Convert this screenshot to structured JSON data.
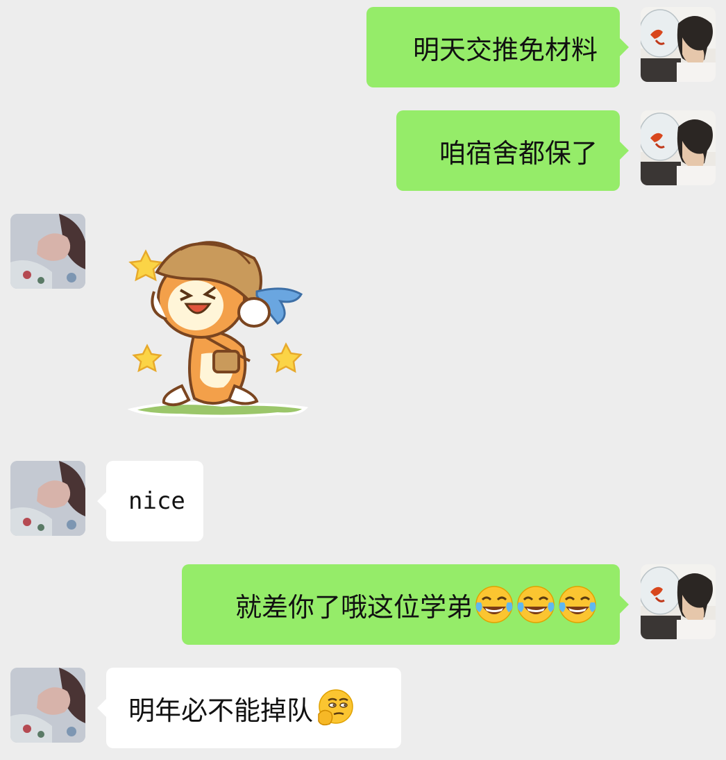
{
  "messages": [
    {
      "side": "me",
      "text": "明天交推免材料"
    },
    {
      "side": "me",
      "text": "咱宿舍都保了"
    },
    {
      "side": "them",
      "type": "sticker",
      "sticker": "running-puppy-with-hat-sticker"
    },
    {
      "side": "them",
      "text": "nice"
    },
    {
      "side": "me",
      "text": "就差你了哦这位学弟",
      "emojis": [
        "tears-of-joy-icon",
        "tears-of-joy-icon",
        "tears-of-joy-icon"
      ]
    },
    {
      "side": "them",
      "text": "明年必不能掉队",
      "emojis": [
        "smirk-thinking-icon"
      ]
    }
  ],
  "avatars": {
    "me": "goldfish-bowl-avatar",
    "them": "blurry-photo-avatar"
  },
  "colors": {
    "background": "#ededed",
    "my_bubble": "#95ec69",
    "their_bubble": "#ffffff",
    "text": "#111111"
  }
}
